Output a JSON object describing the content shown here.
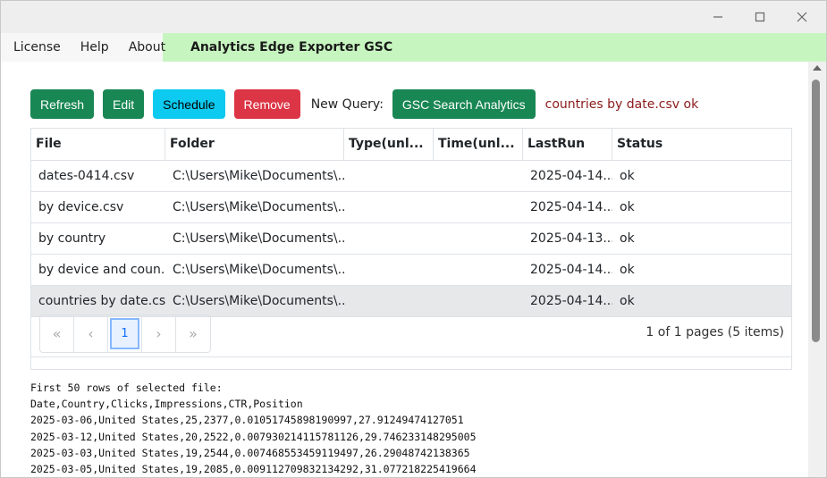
{
  "window": {
    "controls": [
      "minimize-icon",
      "maximize-icon",
      "close-icon"
    ]
  },
  "menu": {
    "items": [
      "License",
      "Help",
      "About"
    ],
    "app_title": "Analytics Edge Exporter GSC",
    "accent": "#c7f5c0"
  },
  "toolbar": {
    "refresh": "Refresh",
    "edit": "Edit",
    "schedule": "Schedule",
    "remove": "Remove",
    "new_query_label": "New Query:",
    "gsc_search": "GSC Search Analytics",
    "status": "countries by date.csv ok"
  },
  "grid": {
    "columns": [
      "File",
      "Folder",
      "Type(unl...",
      "Time(unl...",
      "LastRun",
      "Status"
    ],
    "rows": [
      {
        "file": "dates-0414.csv",
        "folder": "C:\\Users\\Mike\\Documents\\...",
        "type": "",
        "time": "",
        "lastrun": "2025-04-14...",
        "status": "ok"
      },
      {
        "file": "by device.csv",
        "folder": "C:\\Users\\Mike\\Documents\\...",
        "type": "",
        "time": "",
        "lastrun": "2025-04-14...",
        "status": "ok"
      },
      {
        "file": "by country",
        "folder": "C:\\Users\\Mike\\Documents\\...",
        "type": "",
        "time": "",
        "lastrun": "2025-04-13...",
        "status": "ok"
      },
      {
        "file": "by device and coun...",
        "folder": "C:\\Users\\Mike\\Documents\\...",
        "type": "",
        "time": "",
        "lastrun": "2025-04-14...",
        "status": "ok"
      },
      {
        "file": "countries by date.csv",
        "folder": "C:\\Users\\Mike\\Documents\\...",
        "type": "",
        "time": "",
        "lastrun": "2025-04-14...",
        "status": "ok"
      }
    ],
    "selected_row": 4
  },
  "pager": {
    "first": "«",
    "prev": "‹",
    "current_page": "1",
    "next": "›",
    "last": "»",
    "summary": "1 of 1 pages (5 items)"
  },
  "preview": {
    "lines": [
      "First 50 rows of selected file:",
      "Date,Country,Clicks,Impressions,CTR,Position",
      "2025-03-06,United States,25,2377,0.01051745898190997,27.91249474127051",
      "2025-03-12,United States,20,2522,0.007930214115781126,29.746233148295005",
      "2025-03-03,United States,19,2544,0.007468553459119497,26.29048742138365",
      "2025-03-05,United States,19,2085,0.009112709832134292,31.077218225419664"
    ]
  }
}
